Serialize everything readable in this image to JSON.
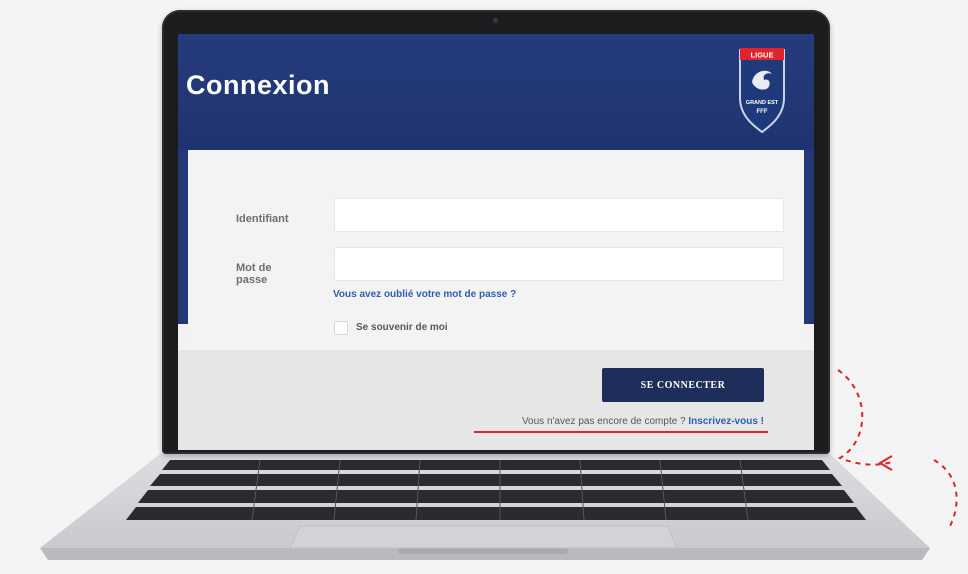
{
  "login_page": {
    "title": "Connexion",
    "logo": {
      "top_text": "LIGUE",
      "middle_text": "GRAND EST",
      "bottom_text": "FFF",
      "colors": {
        "shield": "#1f3a7a",
        "ribbon": "#e0242b"
      }
    },
    "form": {
      "identifier_label": "Identifiant",
      "identifier_value": "",
      "password_label": "Mot de passe",
      "password_value": "",
      "forgot_password_link": "Vous avez oublié votre mot de passe ?",
      "remember_me_label": "Se souvenir de moi",
      "remember_me_checked": false
    },
    "actions": {
      "submit_label": "SE CONNECTER",
      "no_account_text": "Vous n'avez pas encore de compte ? ",
      "signup_link": "Inscrivez-vous !"
    }
  },
  "colors": {
    "header_blue": "#223775",
    "button_navy": "#1f2d5a",
    "link_blue": "#2d5fae",
    "annotation_red": "#e0242b"
  }
}
